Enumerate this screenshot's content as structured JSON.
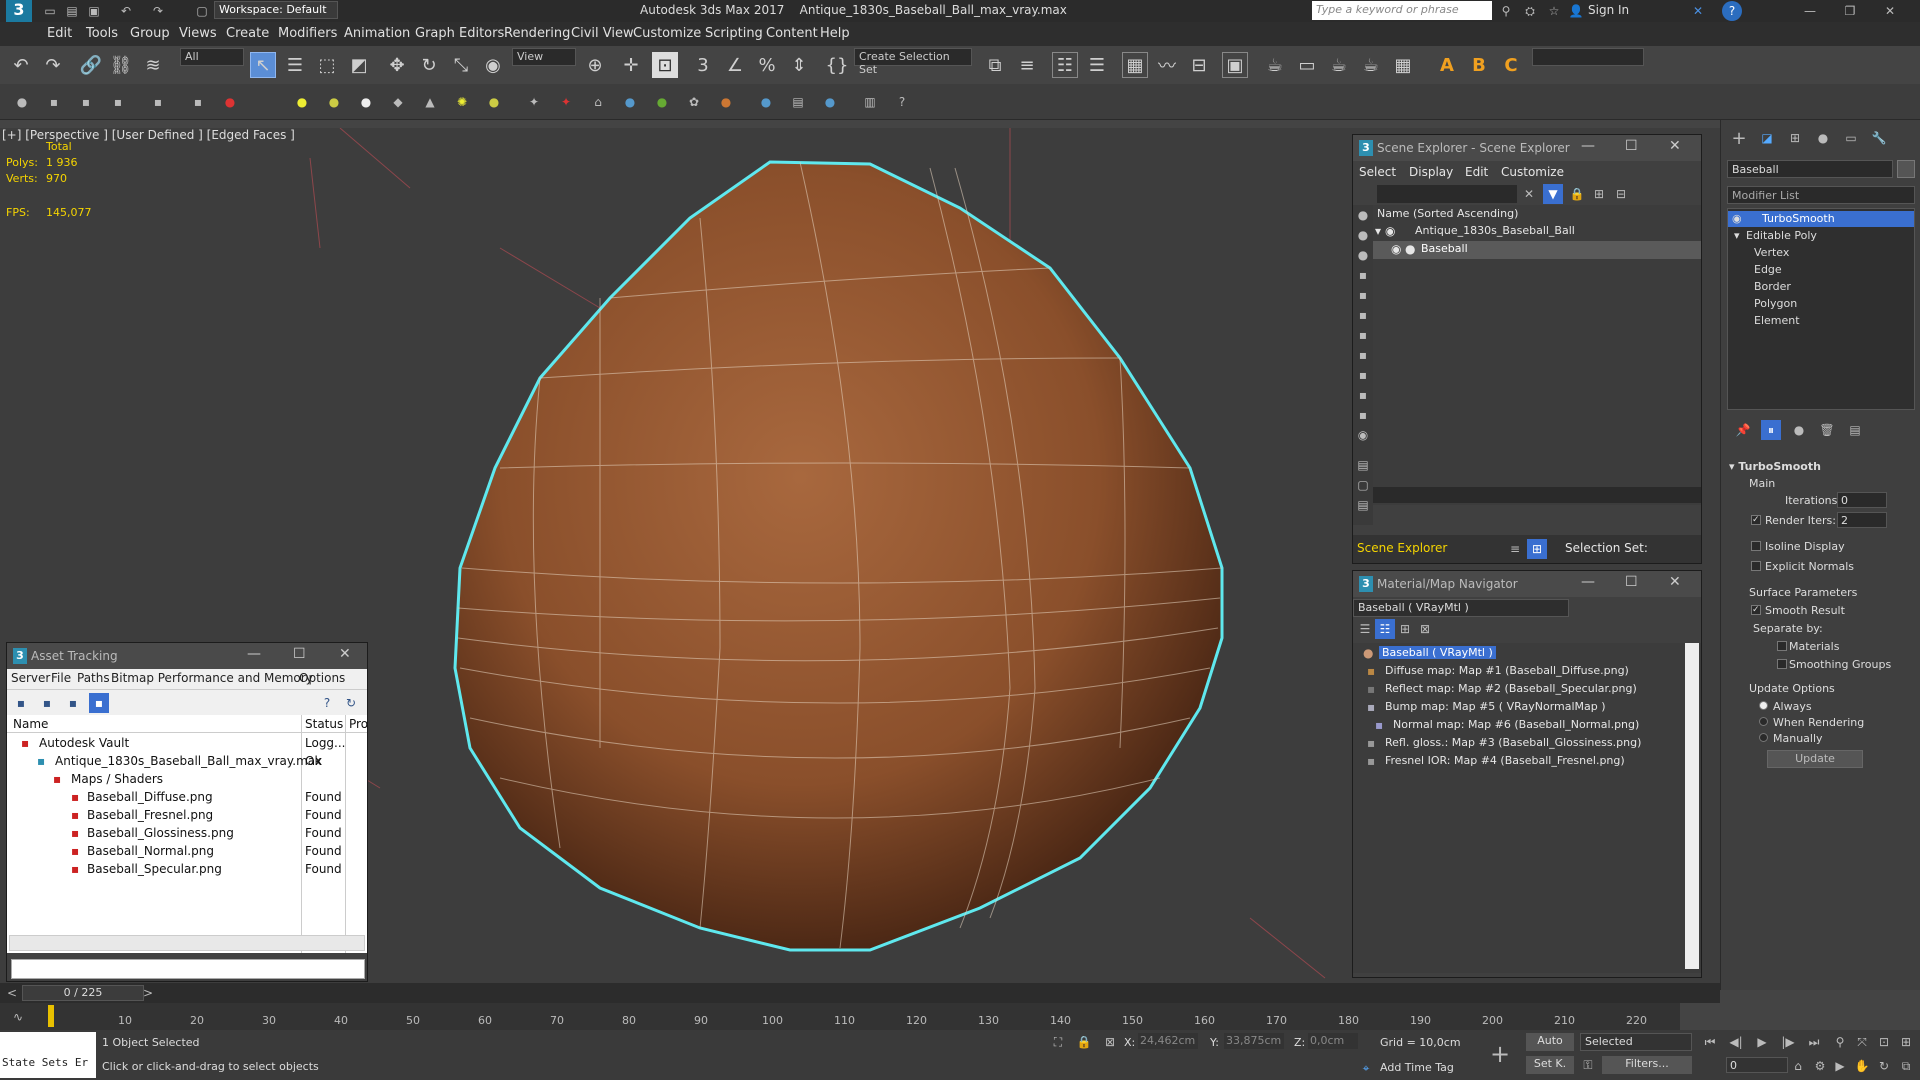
{
  "app": {
    "title": "Autodesk 3ds Max 2017",
    "file": "Antique_1830s_Baseball_Ball_max_vray.max",
    "workspace": "Workspace: Default",
    "search_placeholder": "Type a keyword or phrase",
    "sign_in": "Sign In"
  },
  "menu": [
    "Edit",
    "Tools",
    "Group",
    "Views",
    "Create",
    "Modifiers",
    "Animation",
    "Graph Editors",
    "Rendering",
    "Civil View",
    "Customize",
    "Scripting",
    "Content",
    "Help"
  ],
  "toolbar": {
    "filter_all": "All",
    "view_dropdown": "View",
    "create_selection_set": "Create Selection Set"
  },
  "viewport": {
    "label": "[+] [Perspective ] [User Defined ] [Edged Faces ]",
    "stats_total": "Total",
    "polys_label": "Polys:",
    "polys_value": "1 936",
    "verts_label": "Verts:",
    "verts_value": "970",
    "fps_label": "FPS:",
    "fps_value": "145,077"
  },
  "scene_explorer": {
    "title": "Scene Explorer - Scene Explorer",
    "menu": [
      "Select",
      "Display",
      "Edit",
      "Customize"
    ],
    "column": "Name (Sorted Ascending)",
    "items": [
      "Antique_1830s_Baseball_Ball",
      "Baseball"
    ],
    "footer_left": "Scene Explorer",
    "footer_right": "Selection Set:"
  },
  "material_navigator": {
    "title": "Material/Map Navigator",
    "current": "Baseball  ( VRayMtl )",
    "items": [
      "Baseball  ( VRayMtl )",
      "Diffuse map: Map #1 (Baseball_Diffuse.png)",
      "Reflect map: Map #2 (Baseball_Specular.png)",
      "Bump map: Map #5  ( VRayNormalMap )",
      "Normal map: Map #6 (Baseball_Normal.png)",
      "Refl. gloss.: Map #3 (Baseball_Glossiness.png)",
      "Fresnel IOR: Map #4 (Baseball_Fresnel.png)"
    ]
  },
  "asset_tracking": {
    "title": "Asset Tracking",
    "menu": [
      "Server",
      "File",
      "Paths",
      "Bitmap Performance and Memory",
      "Options"
    ],
    "columns": [
      "Name",
      "Status",
      "Pro"
    ],
    "rows": [
      {
        "name": "Autodesk Vault",
        "status": "Logg..."
      },
      {
        "name": "Antique_1830s_Baseball_Ball_max_vray.max",
        "status": "Ok"
      },
      {
        "name": "Maps / Shaders",
        "status": ""
      },
      {
        "name": "Baseball_Diffuse.png",
        "status": "Found"
      },
      {
        "name": "Baseball_Fresnel.png",
        "status": "Found"
      },
      {
        "name": "Baseball_Glossiness.png",
        "status": "Found"
      },
      {
        "name": "Baseball_Normal.png",
        "status": "Found"
      },
      {
        "name": "Baseball_Specular.png",
        "status": "Found"
      }
    ]
  },
  "command_panel": {
    "object_name": "Baseball",
    "modifier_list": "Modifier List",
    "stack": [
      "TurboSmooth",
      "Editable Poly",
      "Vertex",
      "Edge",
      "Border",
      "Polygon",
      "Element"
    ],
    "rollout": "TurboSmooth",
    "main": "Main",
    "iterations_label": "Iterations:",
    "iterations_value": "0",
    "render_iters_label": "Render Iters:",
    "render_iters_value": "2",
    "isoline": "Isoline Display",
    "explicit_normals": "Explicit Normals",
    "surface_params": "Surface Parameters",
    "smooth_result": "Smooth Result",
    "separate_by": "Separate by:",
    "materials": "Materials",
    "smoothing_groups": "Smoothing Groups",
    "update_options": "Update Options",
    "always": "Always",
    "when_rendering": "When Rendering",
    "manually": "Manually",
    "update_button": "Update"
  },
  "timeline": {
    "frame": "0 / 225",
    "ticks": [
      "10",
      "20",
      "30",
      "40",
      "50",
      "60",
      "70",
      "80",
      "90",
      "100",
      "110",
      "120",
      "130",
      "140",
      "150",
      "160",
      "170",
      "180",
      "190",
      "200",
      "210",
      "220"
    ]
  },
  "status": {
    "state_sets": "State Sets Er",
    "selected": "1 Object Selected",
    "prompt": "Click or click-and-drag to select objects",
    "x_label": "X:",
    "x_value": "24,462cm",
    "y_label": "Y:",
    "y_value": "33,875cm",
    "z_label": "Z:",
    "z_value": "0,0cm",
    "grid": "Grid = 10,0cm",
    "add_time_tag": "Add Time Tag",
    "auto": "Auto",
    "selected_dd": "Selected",
    "set_k": "Set K.",
    "filters": "Filters...",
    "frame_field": "0"
  }
}
